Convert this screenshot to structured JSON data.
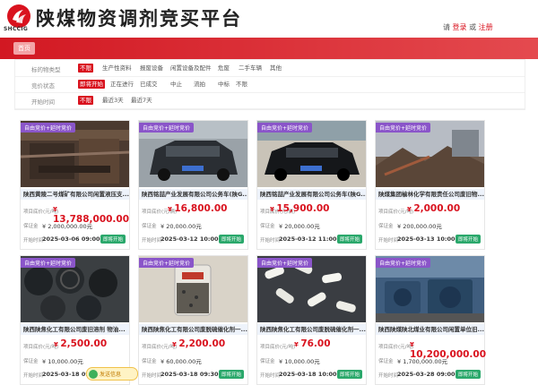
{
  "header": {
    "logo_text": "SHCCIG",
    "title": "陕煤物资调剂竞买平台",
    "login_prefix": "请",
    "login_label": "登录",
    "or_label": "或",
    "register_label": "注册"
  },
  "nav": {
    "home_label": "首页"
  },
  "filters": [
    {
      "label": "标的物类型",
      "options": [
        "不限",
        "生产性资料",
        "报废设备",
        "闲置设备及配件",
        "危废",
        "二手车辆",
        "其他"
      ],
      "active": 0
    },
    {
      "label": "竞价状态",
      "options": [
        "即将开始",
        "正在进行",
        "已成交",
        "中止",
        "流拍",
        "中标",
        "不限"
      ],
      "active": 0
    },
    {
      "label": "开始时间",
      "options": [
        "不限",
        "最近3天",
        "最近7天"
      ],
      "active": 0
    }
  ],
  "cards": [
    {
      "tag": "自由竞价+延时竞价",
      "title": "陕西黄陵二号煤矿有限公司闲置液压支...",
      "price_label": "项目底价(元/吨)",
      "price": "13,788,000.00",
      "deposit_label": "保证金",
      "deposit": "¥ 2,000,000.00元",
      "time_label": "开始时间",
      "time": "2025-03-06 09:00:00",
      "badge": "即将开始",
      "img": "mine"
    },
    {
      "tag": "自由竞价+延时竞价",
      "title": "陕西铭喆产业发展有限公司公务车(陕G...",
      "price_label": "项目底价(元/辆)",
      "price": "16,800.00",
      "deposit_label": "保证金",
      "deposit": "¥ 20,000.00元",
      "time_label": "开始时间",
      "time": "2025-03-12 10:00:00",
      "badge": "即将开始",
      "img": "car-dark"
    },
    {
      "tag": "自由竞价+延时竞价",
      "title": "陕西铭喆产业发展有限公司公务车(陕G...",
      "price_label": "项目底价(元/辆)",
      "price": "15,900.00",
      "deposit_label": "保证金",
      "deposit": "¥ 20,000.00元",
      "time_label": "开始时间",
      "time": "2025-03-12 11:00:00",
      "badge": "即将开始",
      "img": "car-black"
    },
    {
      "tag": "自由竞价+延时竞价",
      "title": "陕煤集团榆林化学有限责任公司废旧物...",
      "price_label": "项目底价(元/吨)",
      "price": "2,000.00",
      "deposit_label": "保证金",
      "deposit": "¥ 200,000.00元",
      "time_label": "开始时间",
      "time": "2025-03-13 10:00:00",
      "badge": "即将开始",
      "img": "scrap"
    },
    {
      "tag": "自由竞价+延时竞价",
      "title": "陕西陕焦化工有限公司废旧溶剂 物油...",
      "price_label": "项目底价(元/吨)",
      "price": "2,500.00",
      "deposit_label": "保证金",
      "deposit": "¥ 10,000.00元",
      "time_label": "开始时间",
      "time": "2025-03-18 09:30:00",
      "badge": "即将开始",
      "img": "drums"
    },
    {
      "tag": "自由竞价+延时竞价",
      "title": "陕西陕焦化工有限公司废脱硫催化剂一...",
      "price_label": "项目底价(元/吨)",
      "price": "2,200.00",
      "deposit_label": "保证金",
      "deposit": "¥ 60,000.00元",
      "time_label": "开始时间",
      "time": "2025-03-18 09:30:00",
      "badge": "即将开始",
      "img": "jar"
    },
    {
      "tag": "自由竞价+延时竞价",
      "title": "陕西陕焦化工有限公司废脱硫催化剂一...",
      "price_label": "项目底价(元/吨)",
      "price": "76.00",
      "deposit_label": "保证金",
      "deposit": "¥ 10,000.00元",
      "time_label": "开始时间",
      "time": "2025-03-18 10:00:00",
      "badge": "即将开始",
      "img": "pellets"
    },
    {
      "tag": "自由竞价+延时竞价",
      "title": "陕西陕煤陕北煤业有限公司闲置单位旧...",
      "price_label": "项目底价(元/吨)",
      "price": "10,200,000.00",
      "deposit_label": "保证金",
      "deposit": "¥ 1,700,000.00元",
      "time_label": "开始时间",
      "time": "2025-03-28 09:00:00",
      "badge": "即将开始",
      "img": "motors"
    }
  ],
  "float_widget": {
    "label": "发送信息"
  },
  "colors": {
    "brand_red": "#d9121e",
    "tag_purple": "#8a55c9",
    "badge_green": "#2aa86b",
    "title_bg": "#eef3fb"
  }
}
